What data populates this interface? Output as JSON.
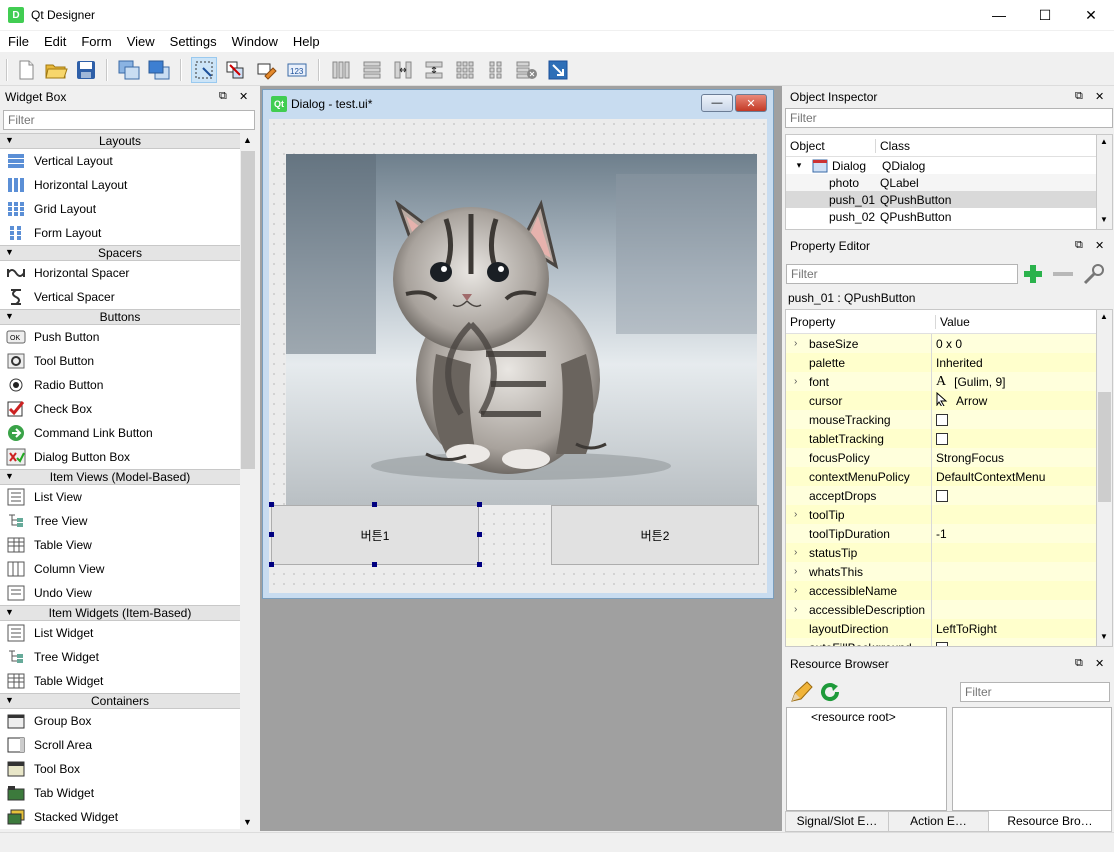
{
  "window": {
    "title": "Qt Designer",
    "icon_letter": "D",
    "minimize": "—",
    "maximize": "☐",
    "close": "✕"
  },
  "menu": [
    "File",
    "Edit",
    "Form",
    "View",
    "Settings",
    "Window",
    "Help"
  ],
  "widget_box": {
    "title": "Widget Box",
    "filter_placeholder": "Filter",
    "categories": [
      {
        "name": "Layouts",
        "items": [
          "Vertical Layout",
          "Horizontal Layout",
          "Grid Layout",
          "Form Layout"
        ]
      },
      {
        "name": "Spacers",
        "items": [
          "Horizontal Spacer",
          "Vertical Spacer"
        ]
      },
      {
        "name": "Buttons",
        "items": [
          "Push Button",
          "Tool Button",
          "Radio Button",
          "Check Box",
          "Command Link Button",
          "Dialog Button Box"
        ]
      },
      {
        "name": "Item Views (Model-Based)",
        "items": [
          "List View",
          "Tree View",
          "Table View",
          "Column View",
          "Undo View"
        ]
      },
      {
        "name": "Item Widgets (Item-Based)",
        "items": [
          "List Widget",
          "Tree Widget",
          "Table Widget"
        ]
      },
      {
        "name": "Containers",
        "items": [
          "Group Box",
          "Scroll Area",
          "Tool Box",
          "Tab Widget",
          "Stacked Widget"
        ]
      }
    ]
  },
  "dialog": {
    "title": "Dialog - test.ui*",
    "badge": "Qt",
    "button1": "버튼1",
    "button2": "버튼2"
  },
  "object_inspector": {
    "title": "Object Inspector",
    "filter_placeholder": "Filter",
    "columns": [
      "Object",
      "Class"
    ],
    "rows": [
      {
        "object": "Dialog",
        "class": "QDialog"
      },
      {
        "object": "photo",
        "class": "QLabel"
      },
      {
        "object": "push_01",
        "class": "QPushButton"
      },
      {
        "object": "push_02",
        "class": "QPushButton"
      }
    ]
  },
  "property_editor": {
    "title": "Property Editor",
    "filter_placeholder": "Filter",
    "object_label": "push_01 : QPushButton",
    "columns": [
      "Property",
      "Value"
    ],
    "rows": [
      {
        "name": "baseSize",
        "value": "0 x 0",
        "expand": true
      },
      {
        "name": "palette",
        "value": "Inherited"
      },
      {
        "name": "font",
        "value": "[Gulim, 9]",
        "expand": true
      },
      {
        "name": "cursor",
        "value": "Arrow"
      },
      {
        "name": "mouseTracking",
        "value": ""
      },
      {
        "name": "tabletTracking",
        "value": ""
      },
      {
        "name": "focusPolicy",
        "value": "StrongFocus"
      },
      {
        "name": "contextMenuPolicy",
        "value": "DefaultContextMenu"
      },
      {
        "name": "acceptDrops",
        "value": ""
      },
      {
        "name": "toolTip",
        "value": "",
        "expand": true
      },
      {
        "name": "toolTipDuration",
        "value": "-1"
      },
      {
        "name": "statusTip",
        "value": "",
        "expand": true
      },
      {
        "name": "whatsThis",
        "value": "",
        "expand": true
      },
      {
        "name": "accessibleName",
        "value": "",
        "expand": true
      },
      {
        "name": "accessibleDescription",
        "value": "",
        "expand": true
      },
      {
        "name": "layoutDirection",
        "value": "LeftToRight"
      },
      {
        "name": "autoFillBackground",
        "value": ""
      }
    ]
  },
  "resource_browser": {
    "title": "Resource Browser",
    "filter_placeholder": "Filter",
    "root": "<resource root>",
    "tabs": [
      "Signal/Slot E…",
      "Action E…",
      "Resource Bro…"
    ]
  },
  "colors": {
    "accent": "#cce4f7",
    "property_bg": "#ffffcc",
    "selection": "#d9d9d9"
  }
}
